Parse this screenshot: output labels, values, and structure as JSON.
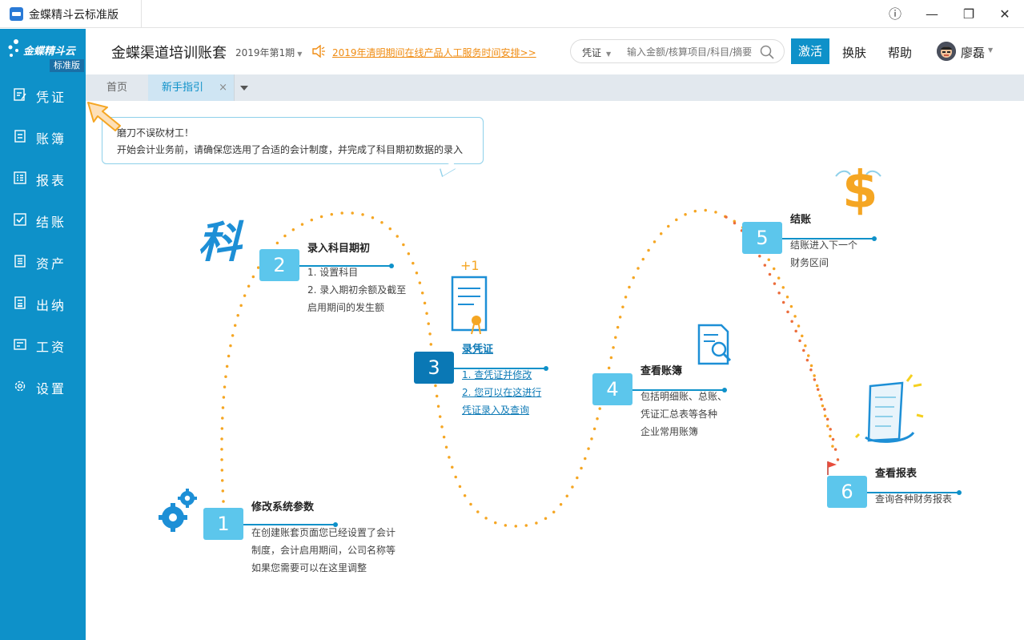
{
  "window": {
    "title": "金蝶精斗云标准版",
    "buttons": {
      "info": "ⓘ",
      "minimize": "—",
      "maximize": "❐",
      "close": "✕"
    }
  },
  "sidebar": {
    "brand": "金蝶精斗云",
    "edition": "标准版",
    "items": [
      {
        "label": "凭证",
        "icon": "voucher-icon"
      },
      {
        "label": "账簿",
        "icon": "ledger-icon"
      },
      {
        "label": "报表",
        "icon": "report-icon"
      },
      {
        "label": "结账",
        "icon": "checkout-icon"
      },
      {
        "label": "资产",
        "icon": "asset-icon"
      },
      {
        "label": "出纳",
        "icon": "cashier-icon"
      },
      {
        "label": "工资",
        "icon": "salary-icon"
      },
      {
        "label": "设置",
        "icon": "gear-icon"
      }
    ],
    "color": "#0e91c9"
  },
  "header": {
    "account_name": "金蝶渠道培训账套",
    "period": "2019年第1期",
    "notice": "2019年清明期间在线产品人工服务时间安排>>",
    "search": {
      "type": "凭证",
      "placeholder": "输入金额/核算项目/科目/摘要"
    },
    "activate": "激活",
    "skin": "换肤",
    "help": "帮助",
    "user": "廖磊"
  },
  "tabs": {
    "home": "首页",
    "guide": "新手指引",
    "close": "×"
  },
  "tip": {
    "line1": "磨刀不误砍材工！",
    "line2": "开始会计业务前，请确保您选用了合适的会计制度，并完成了科目期初数据的录入"
  },
  "steps": [
    {
      "num": "1",
      "title": "修改系统参数",
      "desc": [
        "在创建账套页面您已经设置了会计",
        "制度，会计启用期间，公司名称等",
        "如果您需要可以在这里调整"
      ]
    },
    {
      "num": "2",
      "title": "录入科目期初",
      "desc": [
        "1. 设置科目",
        "2. 录入期初余额及截至",
        "启用期间的发生额"
      ],
      "deco": "科"
    },
    {
      "num": "3",
      "title": "录凭证",
      "desc": [
        "1. 查凭证并修改",
        "2. 您可以在这进行",
        "凭证录入及查询"
      ],
      "deco": "+1"
    },
    {
      "num": "4",
      "title": "查看账簿",
      "desc": [
        "包括明细账、总账、",
        "凭证汇总表等各种",
        "企业常用账簿"
      ]
    },
    {
      "num": "5",
      "title": "结账",
      "desc": [
        "结账进入下一个",
        "财务区间"
      ],
      "deco": "$"
    },
    {
      "num": "6",
      "title": "查看报表",
      "desc": [
        "查询各种财务报表"
      ]
    }
  ],
  "colors": {
    "accent": "#0e91c9",
    "dots": "#f5a623",
    "notice": "#f08c12",
    "step": "#5cc6ec"
  }
}
